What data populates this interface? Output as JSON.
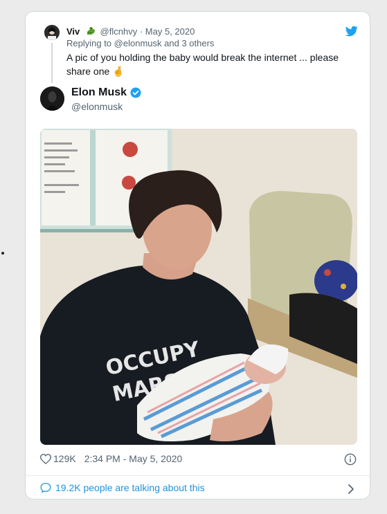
{
  "colors": {
    "link_blue": "#1b95e0",
    "muted": "#536471",
    "text": "#0f1419",
    "card_border": "#cfd9de"
  },
  "reply": {
    "name": "Viv",
    "handle": "@flcnhvy",
    "separator": "·",
    "date": "May 5, 2020",
    "replying_prefix": "Replying to",
    "replying_handle": "@elonmusk",
    "replying_suffix": "and 3 others",
    "text": "A pic of you holding the baby would break the internet ... please share one",
    "text_emoji": "🤞"
  },
  "tweet": {
    "name": "Elon Musk",
    "handle": "@elonmusk",
    "photo_shirt_text_line1": "OCCUPY",
    "photo_shirt_text_line2": "MARS",
    "likes": "129K",
    "time": "2:34 PM - May 5, 2020"
  },
  "footer": {
    "talking": "19.2K people are talking about this"
  },
  "icons": [
    "twitter-bird-icon",
    "dragon-emoji-icon",
    "fingers-crossed-emoji-icon",
    "verified-badge-icon",
    "heart-icon",
    "info-icon",
    "comment-bubble-icon",
    "chevron-right-icon"
  ]
}
